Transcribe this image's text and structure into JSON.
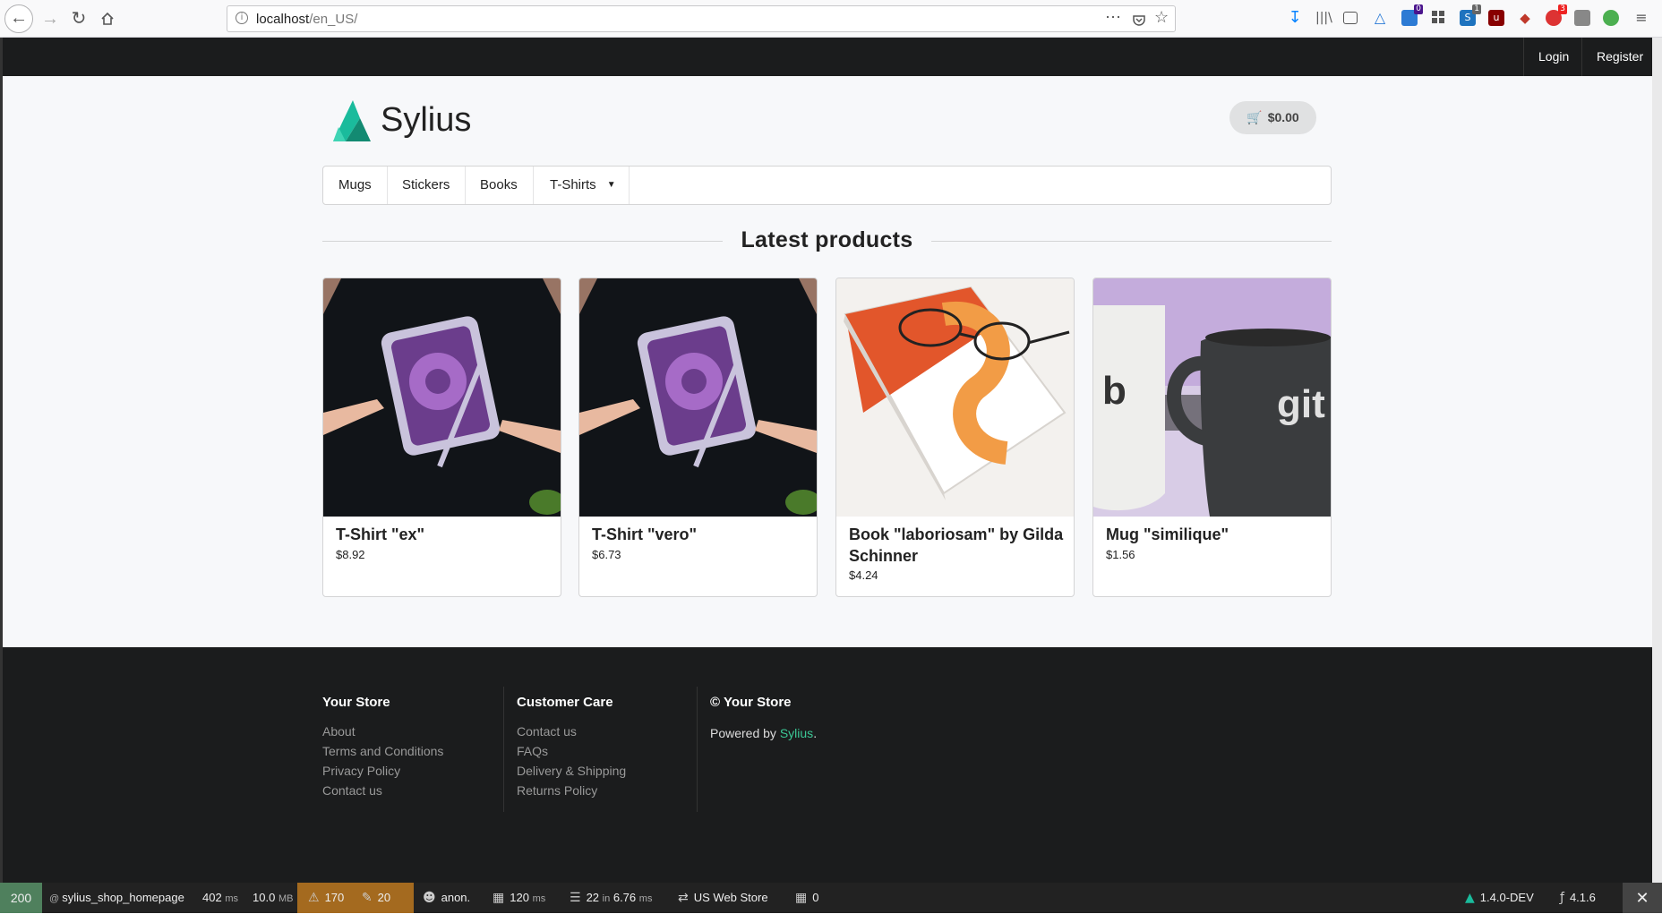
{
  "browser": {
    "url_host": "localhost",
    "url_path": "/en_US/",
    "ext_badges": [
      "0",
      "1",
      "3"
    ]
  },
  "topbar": {
    "login": "Login",
    "register": "Register"
  },
  "header": {
    "logo_text": "Sylius",
    "cart_total": "$0.00"
  },
  "menu": {
    "items": [
      "Mugs",
      "Stickers",
      "Books",
      "T-Shirts"
    ]
  },
  "latest": {
    "title": "Latest products",
    "products": [
      {
        "name": "T-Shirt \"ex\"",
        "price": "$8.92"
      },
      {
        "name": "T-Shirt \"vero\"",
        "price": "$6.73"
      },
      {
        "name": "Book \"laboriosam\" by Gilda Schinner",
        "price": "$4.24"
      },
      {
        "name": "Mug \"similique\"",
        "price": "$1.56"
      }
    ]
  },
  "footer": {
    "store": {
      "title": "Your Store",
      "links": [
        "About",
        "Terms and Conditions",
        "Privacy Policy",
        "Contact us"
      ]
    },
    "care": {
      "title": "Customer Care",
      "links": [
        "Contact us",
        "FAQs",
        "Delivery & Shipping",
        "Returns Policy"
      ]
    },
    "copyright": {
      "title": "© Your Store",
      "powered_prefix": "Powered by ",
      "powered_brand": "Sylius",
      "powered_suffix": "."
    }
  },
  "sf_toolbar": {
    "status": "200",
    "route": "sylius_shop_homepage",
    "time_value": "402",
    "time_unit": "ms",
    "memory_value": "10.0",
    "memory_unit": "MB",
    "warnings": "170",
    "deprecations": "20",
    "user": "anon.",
    "render_value": "120",
    "render_unit": "ms",
    "db_queries": "22",
    "db_in": "in",
    "db_time": "6.76",
    "db_unit": "ms",
    "channel": "US Web Store",
    "forms": "0",
    "sylius_version": "1.4.0-DEV",
    "symfony_version": "4.1.6",
    "colors": {
      "ok": "#4f805d",
      "warning": "#a46a1f"
    }
  }
}
